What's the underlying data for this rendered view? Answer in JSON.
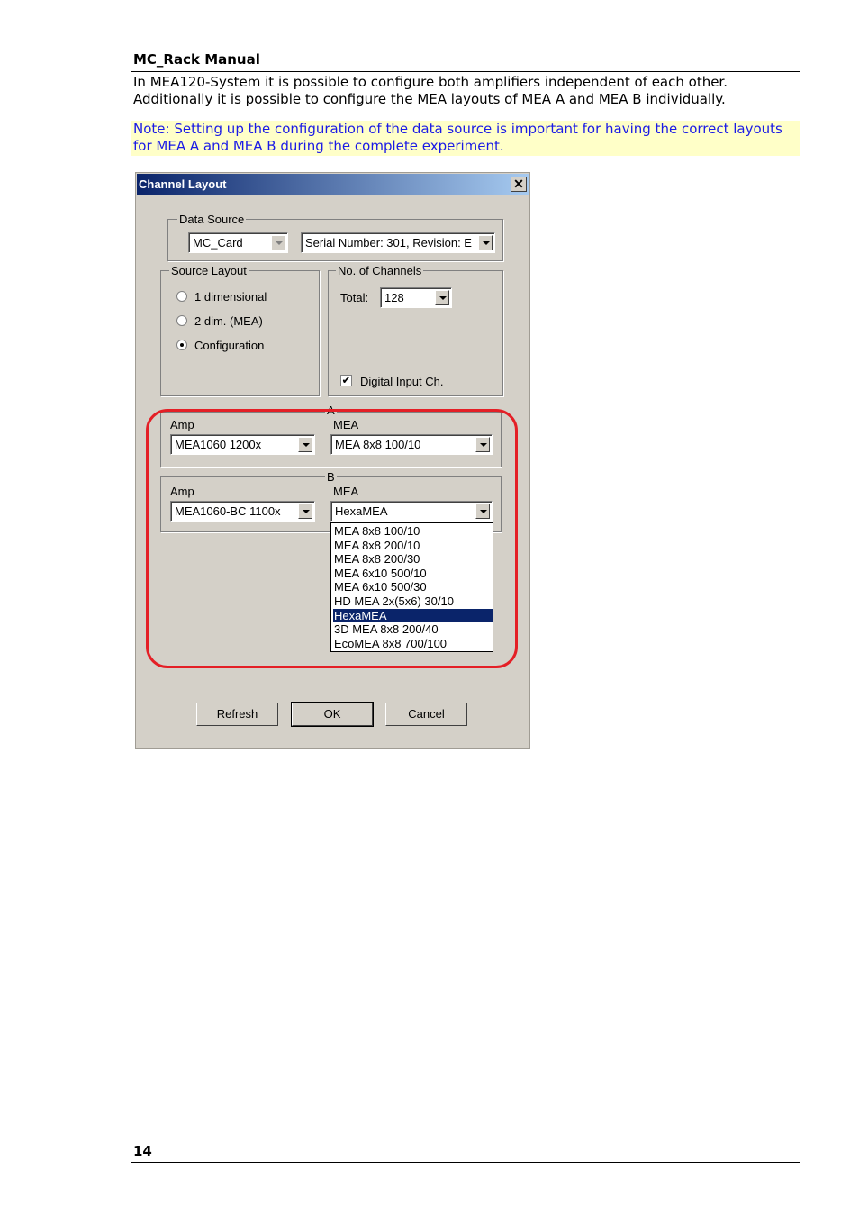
{
  "page": {
    "header": "MC_Rack Manual",
    "paragraph_line1": "In MEA120-System it is possible to configure both amplifiers independent of each other.",
    "paragraph_line2": "Additionally it is possible to configure the MEA layouts of MEA A and MEA B individually.",
    "note_line1": "Note: Setting up the configuration of the data source is important for having the correct layouts",
    "note_line2": "for MEA A and MEA B during the complete experiment.",
    "page_number": "14"
  },
  "dialog": {
    "title": "Channel Layout",
    "close_glyph": "✕",
    "data_source": {
      "label": "Data Source",
      "card": "MC_Card",
      "serial": "Serial Number: 301, Revision: E"
    },
    "source_layout": {
      "label": "Source Layout",
      "options": [
        "1 dimensional",
        "2 dim. (MEA)",
        "Configuration"
      ],
      "selected": "Configuration"
    },
    "channels": {
      "label": "No. of Channels",
      "total_label": "Total:",
      "total_value": "128",
      "digital_label": "Digital Input Ch.",
      "digital_checked": true,
      "check_glyph": "✔"
    },
    "group_a": {
      "label": "A",
      "amp_label": "Amp",
      "amp_value": "MEA1060 1200x",
      "mea_label": "MEA",
      "mea_value": "MEA 8x8 100/10"
    },
    "group_b": {
      "label": "B",
      "amp_label": "Amp",
      "amp_value": "MEA1060-BC 1100x",
      "mea_label": "MEA",
      "mea_value": "HexaMEA",
      "dropdown_options": [
        "MEA 8x8 100/10",
        "MEA 8x8 200/10",
        "MEA 8x8 200/30",
        "MEA 6x10 500/10",
        "MEA 6x10 500/30",
        "HD MEA 2x(5x6) 30/10",
        "HexaMEA",
        "3D MEA 8x8 200/40",
        "EcoMEA 8x8 700/100"
      ],
      "dropdown_selected": "HexaMEA"
    },
    "buttons": {
      "refresh": "Refresh",
      "ok": "OK",
      "cancel": "Cancel"
    },
    "highlight_color": "#e41f26",
    "title_color": "#0a246a"
  }
}
